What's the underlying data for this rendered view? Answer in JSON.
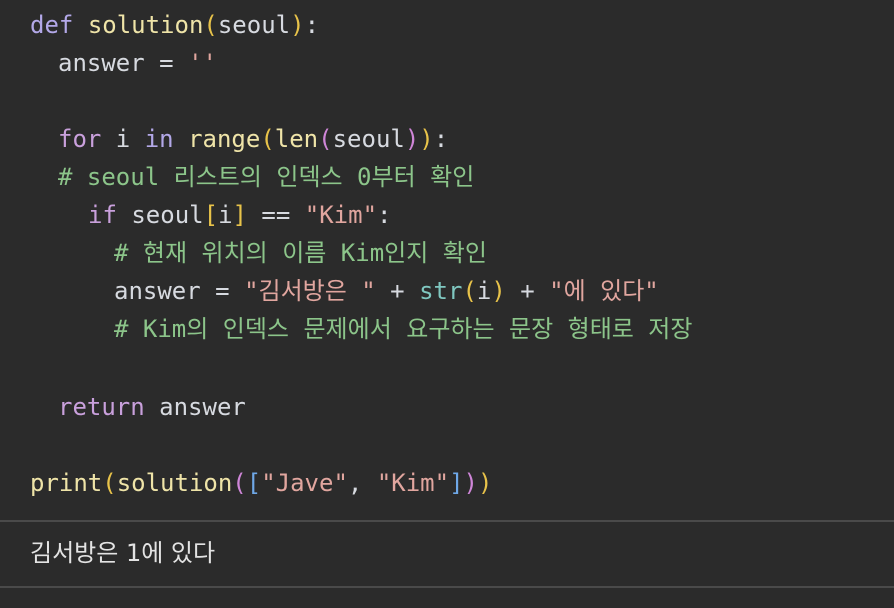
{
  "code": {
    "line1": {
      "def": "def",
      "name": "solution",
      "paren_open": "(",
      "param": "seoul",
      "paren_close": ")",
      "colon": ":"
    },
    "line2": {
      "var": "answer",
      "eq": " = ",
      "str": "''"
    },
    "line4": {
      "for": "for",
      "i": " i ",
      "in": "in",
      "range": " range",
      "p1": "(",
      "len": "len",
      "p2": "(",
      "arg": "seoul",
      "p2c": ")",
      "p1c": ")",
      "colon": ":"
    },
    "line5": {
      "comment": "# seoul 리스트의 인덱스 0부터 확인"
    },
    "line6": {
      "if": "if",
      "seoul": " seoul",
      "b_open": "[",
      "i": "i",
      "b_close": "]",
      "eq": " == ",
      "str": "\"Kim\"",
      "colon": ":"
    },
    "line7": {
      "comment": "# 현재 위치의 이름 Kim인지 확인"
    },
    "line8": {
      "var": "answer",
      "eq": " = ",
      "str1": "\"김서방은 \"",
      "plus1": " + ",
      "str_fn": "str",
      "p_open": "(",
      "i": "i",
      "p_close": ")",
      "plus2": " + ",
      "str2": "\"에 있다\""
    },
    "line9": {
      "comment": "# Kim의 인덱스 문제에서 요구하는 문장 형태로 저장"
    },
    "line11": {
      "ret": "return",
      "var": " answer"
    },
    "line13": {
      "print": "print",
      "p1": "(",
      "fn": "solution",
      "p2": "(",
      "b_open": "[",
      "s1": "\"Jave\"",
      "comma": ", ",
      "s2": "\"Kim\"",
      "b_close": "]",
      "p2c": ")",
      "p1c": ")"
    }
  },
  "output": {
    "text": "김서방은 1에 있다"
  }
}
